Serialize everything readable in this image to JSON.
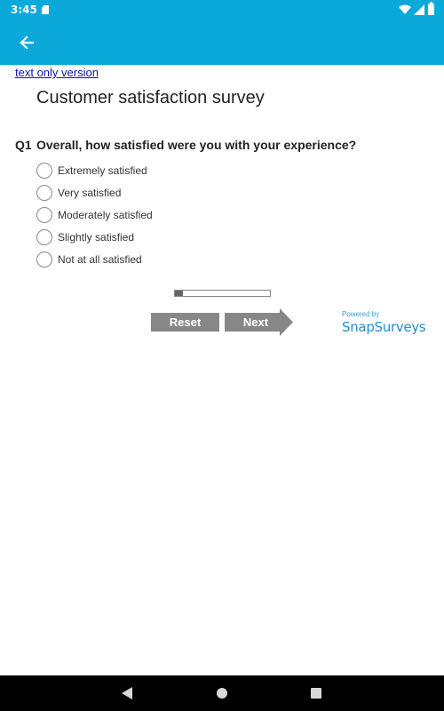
{
  "status_bar": {
    "time": "3:45",
    "icons": [
      "sd-card-icon",
      "wifi-icon",
      "signal-icon",
      "battery-icon"
    ]
  },
  "app_bar": {
    "back_icon": "arrow-left-icon",
    "color": "#0aa9d9"
  },
  "links": {
    "text_only": "text only version"
  },
  "survey": {
    "title": "Customer satisfaction survey",
    "question": {
      "number": "Q1",
      "text": "Overall, how satisfied were you with your experience?",
      "options": [
        {
          "label": "Extremely satisfied"
        },
        {
          "label": "Very satisfied"
        },
        {
          "label": "Moderately satisfied"
        },
        {
          "label": "Slightly satisfied"
        },
        {
          "label": "Not at all satisfied"
        }
      ]
    },
    "progress_fraction": 0.08
  },
  "buttons": {
    "reset": "Reset",
    "next": "Next"
  },
  "branding": {
    "powered_by": "Powered by",
    "name": "SnapSurveys"
  },
  "nav_bar": {
    "icons": [
      "back-triangle-icon",
      "home-circle-icon",
      "recents-square-icon"
    ]
  }
}
